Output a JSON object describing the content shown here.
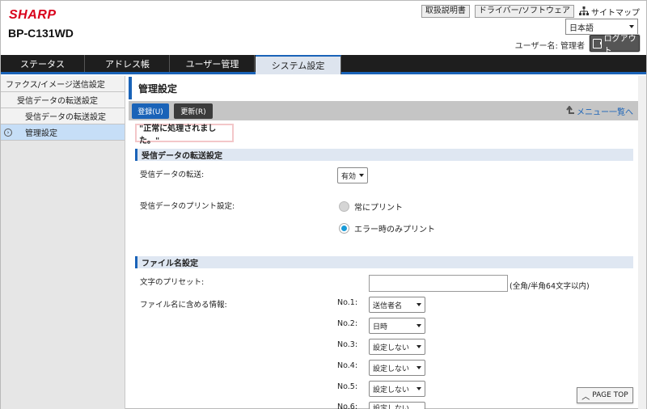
{
  "header": {
    "brand": "SHARP",
    "model": "BP-C131WD",
    "manual_label": "取扱説明書",
    "driver_label": "ドライバー/ソフトウェア",
    "sitemap_label": "サイトマップ",
    "language": "日本語",
    "user_label": "ユーザー名: 管理者",
    "logout_label": "ログアウト"
  },
  "tabs": [
    "ステータス",
    "アドレス帳",
    "ユーザー管理",
    "システム設定"
  ],
  "sidebar": {
    "items": [
      {
        "label": "ファクス/イメージ送信設定"
      },
      {
        "label": "受信データの転送設定"
      },
      {
        "label": "受信データの転送設定"
      },
      {
        "label": "管理設定"
      }
    ]
  },
  "main": {
    "title": "管理設定",
    "register_label": "登録(U)",
    "refresh_label": "更新(R)",
    "menu_list_label": "メニュー一覧へ",
    "message": "\"正常に処理されました。\"",
    "section1": {
      "title": "受信データの転送設定",
      "transfer_label": "受信データの転送:",
      "transfer_value": "有効",
      "print_label": "受信データのプリント設定:",
      "radio_always": "常にプリント",
      "radio_error": "エラー時のみプリント"
    },
    "section2": {
      "title": "ファイル名設定",
      "preset_label": "文字のプリセット:",
      "preset_value": "",
      "preset_hint": "(全角/半角64文字以内)",
      "info_label": "ファイル名に含める情報:",
      "rows": [
        {
          "no": "No.1:",
          "value": "送信者名"
        },
        {
          "no": "No.2:",
          "value": "日時"
        },
        {
          "no": "No.3:",
          "value": "設定しない"
        },
        {
          "no": "No.4:",
          "value": "設定しない"
        },
        {
          "no": "No.5:",
          "value": "設定しない"
        },
        {
          "no": "No.6:",
          "value": "設定しない"
        }
      ]
    },
    "page_top_label": "PAGE TOP"
  },
  "colors": {
    "brand": "#d9001b",
    "accent": "#1a63b8",
    "radio_on": "#1a9bd8"
  }
}
